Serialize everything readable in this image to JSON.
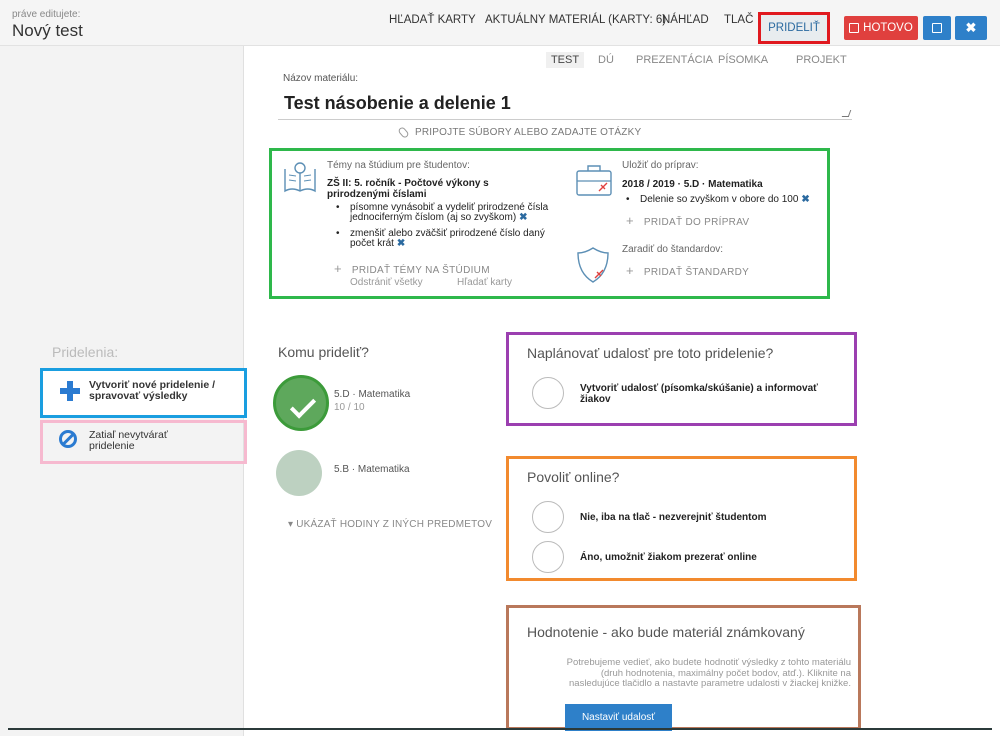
{
  "header": {
    "editing_label": "práve editujete:",
    "title": "Nový test",
    "nav": {
      "hladat_karty": "HĽADAŤ KARTY",
      "aktualny_material": "AKTUÁLNY MATERIÁL (KARTY: 6)",
      "nahlad": "NÁHĽAD",
      "tlac": "TLAČ",
      "pridelit": "PRIDELIŤ"
    },
    "done_label": "HOTOVO",
    "close_label": "✖",
    "accent_red": "#e0403e",
    "accent_blue": "#2e80c9"
  },
  "material_tabs": [
    "TEST",
    "DÚ",
    "PREZENTÁCIA",
    "PÍSOMKA",
    "PROJEKT"
  ],
  "material": {
    "name_label": "Názov materiálu:",
    "name_value": "Test násobenie a delenie 1",
    "attach_label": "PRIPOJTE SÚBORY ALEBO ZADAJTE OTÁZKY"
  },
  "topics": {
    "label": "Témy na štúdium pre študentov:",
    "heading": "ZŠ II: 5. ročník - Počtové výkony s prirodzenými číslami",
    "items": [
      "písomne vynásobiť a vydeliť prirodzené čísla jednociferným číslom (aj so zvyškom)",
      "zmenšiť alebo zväčšiť prirodzené číslo daný počet krát"
    ],
    "x_symbol": "✖",
    "add_label": "PRIDAŤ TÉMY NA ŠTÚDIUM",
    "remove_all": "Odstrániť všetky",
    "search_cards": "Hľadať karty",
    "plus": "+"
  },
  "preparations": {
    "label": "Uložiť do príprav:",
    "heading": "2018 / 2019 · 5.D · Matematika",
    "items": [
      "Delenie so zvyškom v obore do 100"
    ],
    "add_label": "PRIDAŤ DO PRÍPRAV"
  },
  "standards": {
    "label": "Zaradiť do štandardov:",
    "add_label": "PRIDAŤ ŠTANDARDY"
  },
  "sidebar": {
    "title": "Pridelenia:",
    "create_label": "Vytvoriť nové pridelenie / spravovať výsledky",
    "skip_label": "Zatiaľ nevytvárať pridelenie"
  },
  "assign": {
    "title": "Komu prideliť?",
    "classes": [
      {
        "name": "5.D · Matematika",
        "count": "10 / 10",
        "selected": true
      },
      {
        "name": "5.B · Matematika",
        "selected": false
      }
    ],
    "more_label": "UKÁZAŤ HODINY Z INÝCH PREDMETOV",
    "more_arrow": "▾"
  },
  "schedule": {
    "title": "Naplánovať udalosť pre toto pridelenie?",
    "option": "Vytvoriť udalosť (písomka/skúšanie) a informovať žiakov"
  },
  "online": {
    "title": "Povoliť online?",
    "options": [
      "Nie, iba na tlač - nezverejniť študentom",
      "Áno, umožniť žiakom prezerať online"
    ]
  },
  "grading": {
    "title": "Hodnotenie - ako bude materiál známkovaný",
    "description": "Potrebujeme vedieť, ako budete hodnotiť výsledky z tohto materiálu (druh hodnotenia, maximálny počet bodov, atď.). Kliknite na nasledujúce tlačidlo a nastavte parametre udalosti v žiackej knižke.",
    "button_label": "Nastaviť udalosť"
  },
  "highlight_colors": {
    "red": "#e0191f",
    "blue": "#1a9ee0",
    "pink": "#f6b9cf",
    "green": "#2eb84b",
    "purple": "#9b3fb0",
    "orange": "#f28a2e",
    "brown": "#b9785b"
  }
}
